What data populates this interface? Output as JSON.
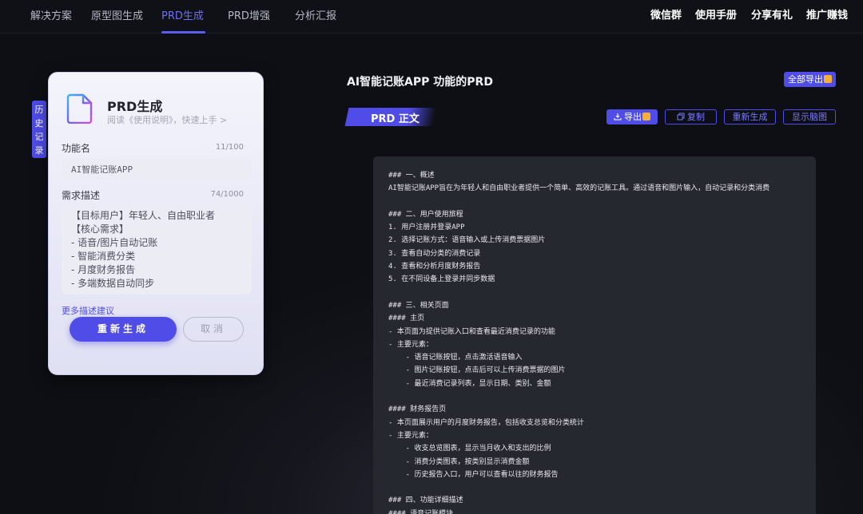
{
  "nav": {
    "items": [
      "解决方案",
      "原型图生成",
      "PRD生成",
      "PRD增强",
      "分析汇报"
    ],
    "active": "PRD生成",
    "right_items": [
      "微信群",
      "使用手册",
      "分享有礼",
      "推广赚钱"
    ]
  },
  "history_tab": "历史记录",
  "card": {
    "title": "PRD生成",
    "subtitle": "阅读《使用说明》，快速上手 >",
    "feature_label": "功能名",
    "feature_count": "11/100",
    "feature_value": "AI智能记账APP",
    "desc_label": "需求描述",
    "desc_count": "74/1000",
    "desc_lines": [
      "【目标用户】年轻人、自由职业者",
      "【核心需求】",
      "- 语音/图片自动记账",
      "- 智能消费分类",
      "- 月度财务报告",
      "- 多端数据自动同步"
    ],
    "more_link": "更多描述建议",
    "regen_button": "重新生成",
    "cancel_button": "取消"
  },
  "doc": {
    "title": "AI智能记账APP 功能的PRD",
    "export_all": "全部导出",
    "tab_label": "PRD 正文",
    "actions": {
      "export": "导出",
      "copy": "复制",
      "regenerate": "重新生成",
      "mindmap": "显示脑图"
    },
    "lines": [
      "### 一、概述",
      "AI智能记账APP旨在为年轻人和自由职业者提供一个简单、高效的记账工具。通过语音和图片输入，自动记录和分类消费",
      "",
      "### 二、用户使用旅程",
      "1. 用户注册并登录APP",
      "2. 选择记账方式：语音输入或上传消费票据图片",
      "3. 查看自动分类的消费记录",
      "4. 查看和分析月度财务报告",
      "5. 在不同设备上登录并同步数据",
      "",
      "### 三、相关页面",
      "#### 主页",
      "- 本页面为提供记账入口和查看最近消费记录的功能",
      "- 主要元素：",
      "    - 语音记账按钮，点击激活语音输入",
      "    - 图片记账按钮，点击后可以上传消费票据的图片",
      "    - 最近消费记录列表，显示日期、类别、金额",
      "",
      "#### 财务报告页",
      "- 本页面展示用户的月度财务报告，包括收支总览和分类统计",
      "- 主要元素：",
      "    - 收支总览图表，显示当月收入和支出的比例",
      "    - 消费分类图表，按类别显示消费金额",
      "    - 历史报告入口，用户可以查看以往的财务报告",
      "",
      "### 四、功能详细描述",
      "#### 语音记账模块"
    ]
  }
}
